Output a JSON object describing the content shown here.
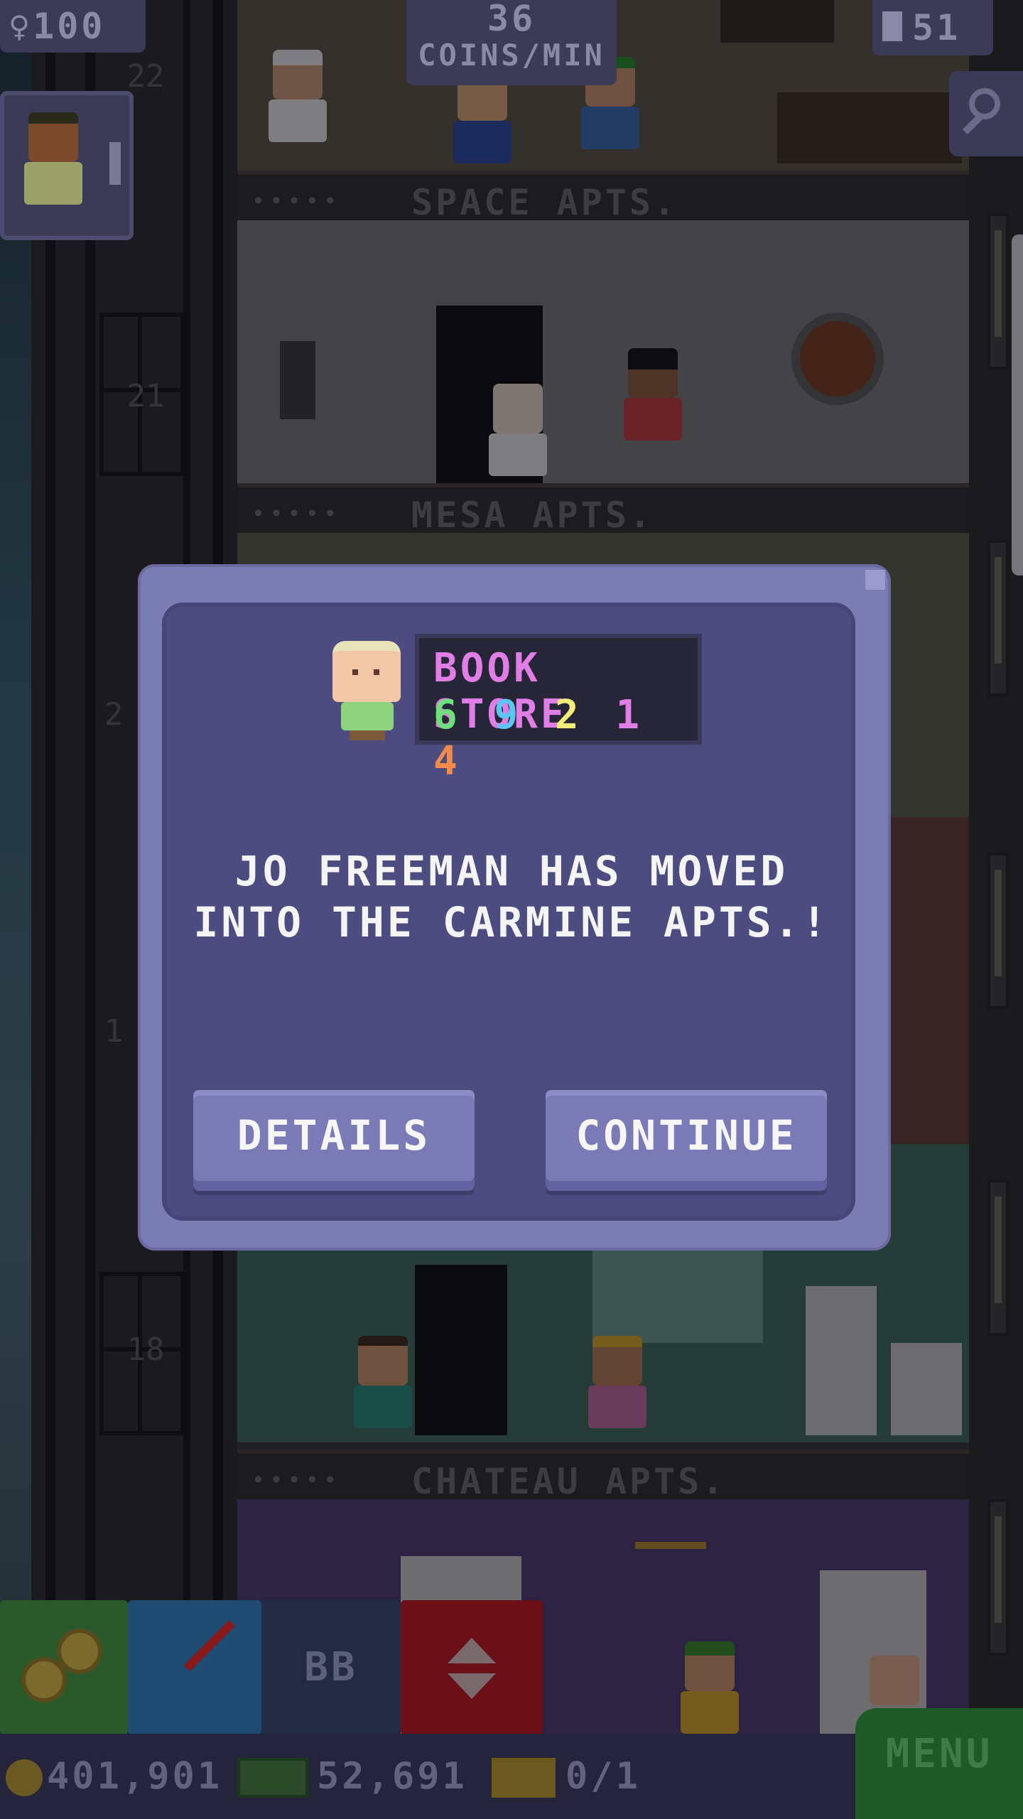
{
  "hud": {
    "population": "♀100",
    "coins_per_min_value": "36",
    "coins_per_min_unit": "COINS/MIN",
    "floors": "51"
  },
  "shaft": {
    "floor_numbers": [
      "22",
      "21",
      "2",
      "1",
      "18"
    ]
  },
  "floors": {
    "space_label": "SPACE APTS.",
    "mesa_label": "MESA APTS.",
    "chateau_label": "CHATEAU APTS.",
    "dots": "•••••"
  },
  "dialog": {
    "job_name": "BOOK STORE",
    "skills": [
      {
        "value": "6",
        "color": "#6ee07a"
      },
      {
        "value": "9",
        "color": "#5cc6f2"
      },
      {
        "value": "2",
        "color": "#f2ee7a"
      },
      {
        "value": "1",
        "color": "#e07ee6"
      },
      {
        "value": "4",
        "color": "#f28a4c"
      }
    ],
    "message": "JO FREEMAN HAS MOVED\nINTO THE CARMINE APTS.!",
    "details_label": "DETAILS",
    "continue_label": "CONTINUE"
  },
  "toolbar": {
    "bb_label": "BB"
  },
  "status": {
    "coins": "401,901",
    "bux": "52,691",
    "tickets": "0/1",
    "menu_label": "MENU"
  }
}
